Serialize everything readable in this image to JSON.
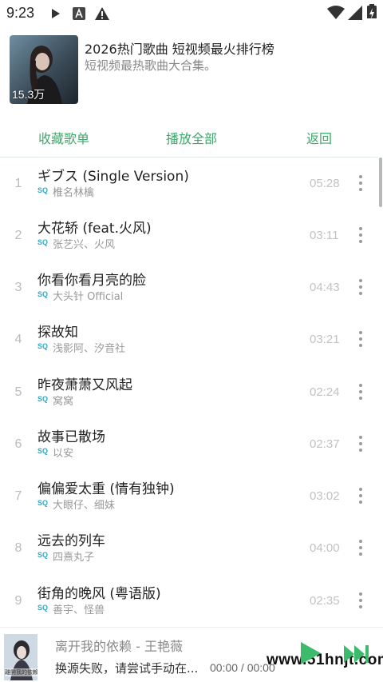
{
  "status_bar": {
    "time": "9:23",
    "icons": [
      "play-icon",
      "text-icon",
      "warning-icon",
      "wifi-icon",
      "signal-icon",
      "battery-icon"
    ]
  },
  "playlist": {
    "title": "2026热门歌曲 短视频最火排行榜",
    "description": "短视频最热歌曲大合集。",
    "play_count": "15.3万"
  },
  "actions": {
    "collect": "收藏歌单",
    "play_all": "播放全部",
    "back": "返回"
  },
  "quality_badge": "SQ",
  "songs": [
    {
      "index": "1",
      "title": "ギブス (Single Version)",
      "artist": "椎名林檎",
      "duration": "05:28"
    },
    {
      "index": "2",
      "title": "大花轿 (feat.火风)",
      "artist": "张艺兴、火风",
      "duration": "03:11"
    },
    {
      "index": "3",
      "title": "你看你看月亮的脸",
      "artist": "大头针 Official",
      "duration": "04:43"
    },
    {
      "index": "4",
      "title": "探故知",
      "artist": "浅影阿、汐音社",
      "duration": "03:21"
    },
    {
      "index": "5",
      "title": "昨夜萧萧又风起",
      "artist": "窝窝",
      "duration": "02:24"
    },
    {
      "index": "6",
      "title": "故事已散场",
      "artist": "以安",
      "duration": "02:37"
    },
    {
      "index": "7",
      "title": "偏偏爱太重 (情有独钟)",
      "artist": "大眼仔、细妹",
      "duration": "03:02"
    },
    {
      "index": "8",
      "title": "远去的列车",
      "artist": "四熹丸子",
      "duration": "04:00"
    },
    {
      "index": "9",
      "title": "街角的晚风 (粤语版)",
      "artist": "善宇、怪兽",
      "duration": "02:35"
    }
  ],
  "player": {
    "now_playing": "离开我的依赖 - 王艳薇",
    "status": "换源失败，请尝试手动在...",
    "time": "00:00 / 00:00",
    "cover_text": "離開我的依賴"
  },
  "watermark": "www.51hnjt.com",
  "colors": {
    "accent": "#3fa86b",
    "sq_badge": "#35a8c4",
    "play_button": "#3dbb6c"
  }
}
